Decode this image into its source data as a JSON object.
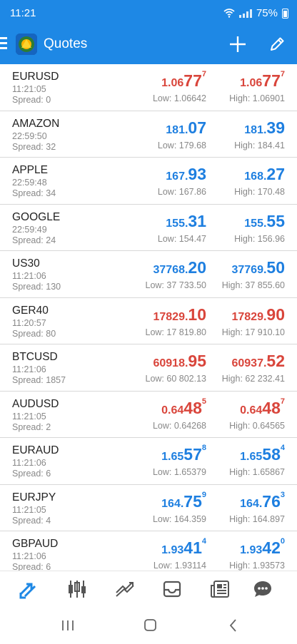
{
  "status": {
    "time": "11:21",
    "battery": "75%"
  },
  "appbar": {
    "title": "Quotes",
    "icons": [
      "menu-icon",
      "app-logo",
      "add-icon",
      "edit-icon"
    ]
  },
  "colors": {
    "bar": "#1e88e5",
    "down": "#d9453b",
    "up": "#1e7fe0"
  },
  "quotes": [
    {
      "symbol": "EURUSD",
      "time": "11:21:05",
      "spread": "Spread: 0",
      "dir": "down",
      "bid": {
        "pre": "1.06",
        "big": "77",
        "sup": "7"
      },
      "ask": {
        "pre": "1.06",
        "big": "77",
        "sup": "7"
      },
      "low": "Low: 1.06642",
      "high": "High: 1.06901"
    },
    {
      "symbol": "AMAZON",
      "time": "22:59:50",
      "spread": "Spread: 32",
      "dir": "up",
      "bid": {
        "pre": "181.",
        "big": "07",
        "sup": ""
      },
      "ask": {
        "pre": "181.",
        "big": "39",
        "sup": ""
      },
      "low": "Low: 179.68",
      "high": "High: 184.41"
    },
    {
      "symbol": "APPLE",
      "time": "22:59:48",
      "spread": "Spread: 34",
      "dir": "up",
      "bid": {
        "pre": "167.",
        "big": "93",
        "sup": ""
      },
      "ask": {
        "pre": "168.",
        "big": "27",
        "sup": ""
      },
      "low": "Low: 167.86",
      "high": "High: 170.48"
    },
    {
      "symbol": "GOOGLE",
      "time": "22:59:49",
      "spread": "Spread: 24",
      "dir": "up",
      "bid": {
        "pre": "155.",
        "big": "31",
        "sup": ""
      },
      "ask": {
        "pre": "155.",
        "big": "55",
        "sup": ""
      },
      "low": "Low: 154.47",
      "high": "High: 156.96"
    },
    {
      "symbol": "US30",
      "time": "11:21:06",
      "spread": "Spread: 130",
      "dir": "up",
      "bid": {
        "pre": "37768.",
        "big": "20",
        "sup": ""
      },
      "ask": {
        "pre": "37769.",
        "big": "50",
        "sup": ""
      },
      "low": "Low: 37 733.50",
      "high": "High: 37 855.60"
    },
    {
      "symbol": "GER40",
      "time": "11:20:57",
      "spread": "Spread: 80",
      "dir": "down",
      "bid": {
        "pre": "17829.",
        "big": "10",
        "sup": ""
      },
      "ask": {
        "pre": "17829.",
        "big": "90",
        "sup": ""
      },
      "low": "Low: 17 819.80",
      "high": "High: 17 910.10"
    },
    {
      "symbol": "BTCUSD",
      "time": "11:21:06",
      "spread": "Spread: 1857",
      "dir": "down",
      "bid": {
        "pre": "60918.",
        "big": "95",
        "sup": ""
      },
      "ask": {
        "pre": "60937.",
        "big": "52",
        "sup": ""
      },
      "low": "Low: 60 802.13",
      "high": "High: 62 232.41"
    },
    {
      "symbol": "AUDUSD",
      "time": "11:21:05",
      "spread": "Spread: 2",
      "dir": "down",
      "bid": {
        "pre": "0.64",
        "big": "48",
        "sup": "5"
      },
      "ask": {
        "pre": "0.64",
        "big": "48",
        "sup": "7"
      },
      "low": "Low: 0.64268",
      "high": "High: 0.64565"
    },
    {
      "symbol": "EURAUD",
      "time": "11:21:06",
      "spread": "Spread: 6",
      "dir": "up",
      "bid": {
        "pre": "1.65",
        "big": "57",
        "sup": "8"
      },
      "ask": {
        "pre": "1.65",
        "big": "58",
        "sup": "4"
      },
      "low": "Low: 1.65379",
      "high": "High: 1.65867"
    },
    {
      "symbol": "EURJPY",
      "time": "11:21:05",
      "spread": "Spread: 4",
      "dir": "up",
      "bid": {
        "pre": "164.",
        "big": "75",
        "sup": "9"
      },
      "ask": {
        "pre": "164.",
        "big": "76",
        "sup": "3"
      },
      "low": "Low: 164.359",
      "high": "High: 164.897"
    },
    {
      "symbol": "GBPAUD",
      "time": "11:21:06",
      "spread": "Spread: 6",
      "dir": "up",
      "bid": {
        "pre": "1.93",
        "big": "41",
        "sup": "4"
      },
      "ask": {
        "pre": "1.93",
        "big": "42",
        "sup": "0"
      },
      "low": "Low: 1.93114",
      "high": "High: 1.93573"
    }
  ],
  "bottom_nav": [
    "quotes-icon",
    "chart-icon",
    "trade-icon",
    "history-icon",
    "news-icon",
    "chat-icon"
  ],
  "system_nav": [
    "recents-icon",
    "home-icon",
    "back-icon"
  ]
}
